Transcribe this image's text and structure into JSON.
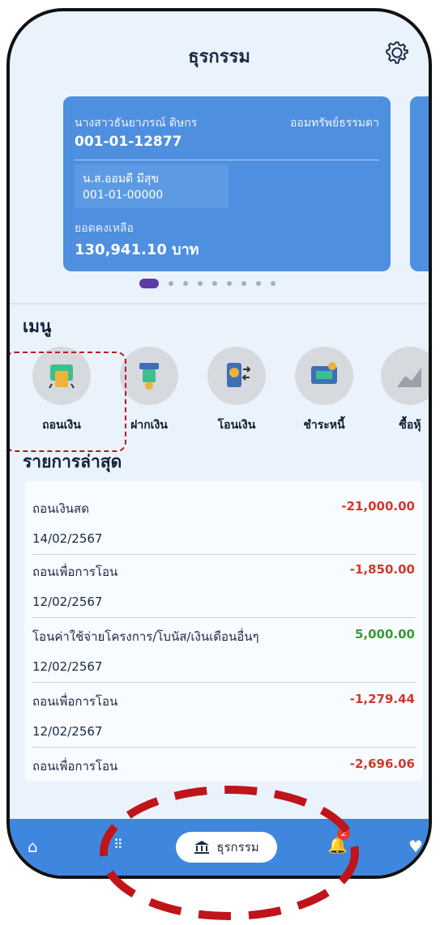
{
  "header": {
    "title": "ธุรกรรม",
    "settings_icon": "gear-icon"
  },
  "card": {
    "holder_name": "นางสาวธันยาภรณ์ ดิษกร",
    "account_type": "ออมทรัพย์ธรรมดา",
    "account_number": "001-01-12877",
    "linked_name": "น.ส.ออมดี มีสุข",
    "linked_number": "001-01-00000",
    "balance_label": "ยอดคงเหลือ",
    "balance": "130,941.10 บาท"
  },
  "menu": {
    "heading": "เมนู",
    "items": [
      {
        "label": "ถอนเงิน",
        "icon": "withdraw-icon"
      },
      {
        "label": "ฝากเงิน",
        "icon": "deposit-icon"
      },
      {
        "label": "โอนเงิน",
        "icon": "transfer-icon"
      },
      {
        "label": "ชำระหนี้",
        "icon": "pay-debt-icon"
      },
      {
        "label": "ซื้อหุ้",
        "icon": "buy-shares-icon"
      }
    ]
  },
  "recent": {
    "heading": "รายการล่าสุด",
    "rows": [
      {
        "desc": "ถอนเงินสด",
        "amount": "-21,000.00",
        "date": "14/02/2567"
      },
      {
        "desc": "ถอนเพื่อการโอน",
        "amount": "-1,850.00",
        "date": "12/02/2567"
      },
      {
        "desc": "โอนค่าใช้จ่ายโครงการ/โบนัส/เงินเดือนอื่นๆ",
        "amount": "5,000.00",
        "date": "12/02/2567"
      },
      {
        "desc": "ถอนเพื่อการโอน",
        "amount": "-1,279.44",
        "date": "12/02/2567"
      },
      {
        "desc": "ถอนเพื่อการโอน",
        "amount": "-2,696.06",
        "date": ""
      }
    ]
  },
  "bottom_nav": {
    "active_label": "ธุรกรรม",
    "notification_count": "2",
    "icons": [
      "home-icon",
      "grid-icon",
      "bank-icon",
      "bell-icon",
      "heart-icon"
    ]
  },
  "colors": {
    "card": "#4e8fe0",
    "nav": "#3f86df",
    "negative": "#d03a2a",
    "positive": "#3a9a37",
    "highlight": "#c0141b"
  }
}
